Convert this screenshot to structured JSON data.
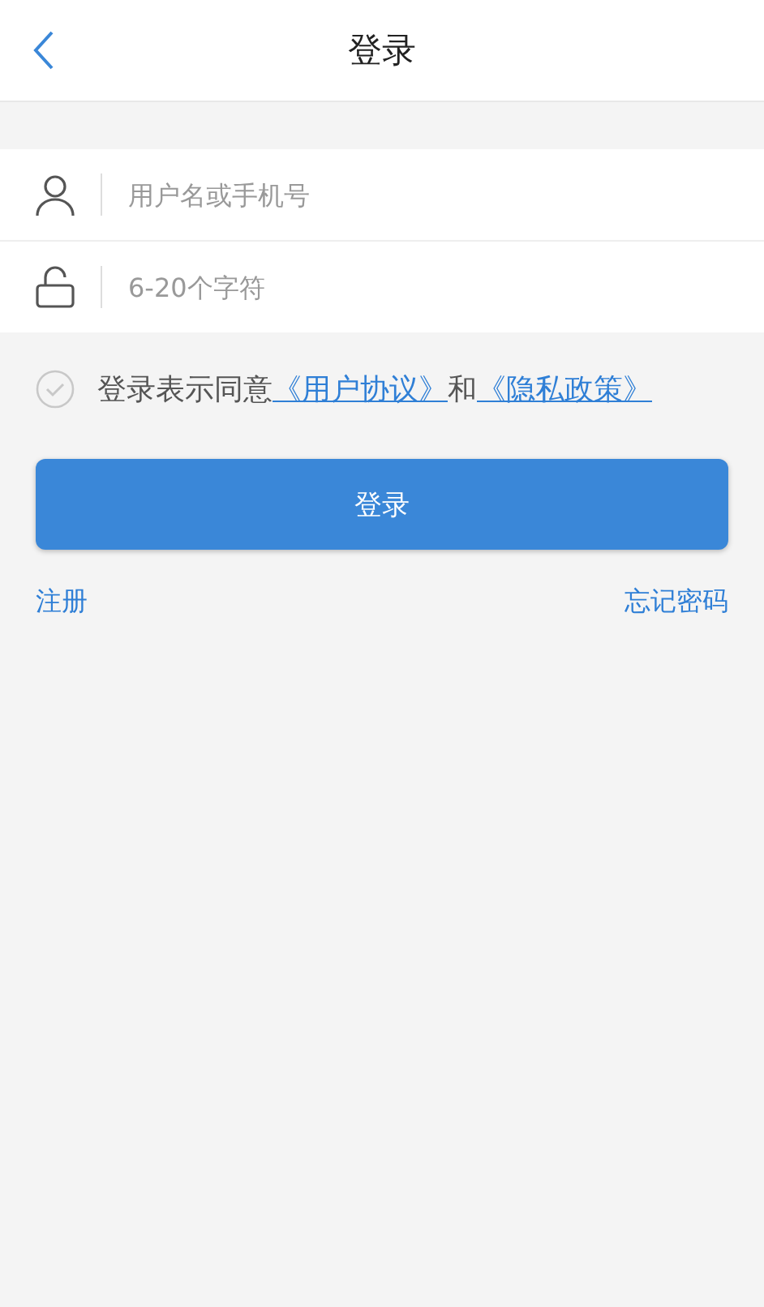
{
  "header": {
    "title": "登录"
  },
  "fields": [
    {
      "kind": "user",
      "placeholder": "用户名或手机号"
    },
    {
      "kind": "lock",
      "placeholder": "6-20个字符"
    }
  ],
  "agreement": {
    "checked": false,
    "text": "登录表示同意",
    "link1": "《用户协议》",
    "joiner": "和",
    "link2": "《隐私政策》"
  },
  "login_button": "登录",
  "links": {
    "register": "注册",
    "forgot": "忘记密码"
  }
}
